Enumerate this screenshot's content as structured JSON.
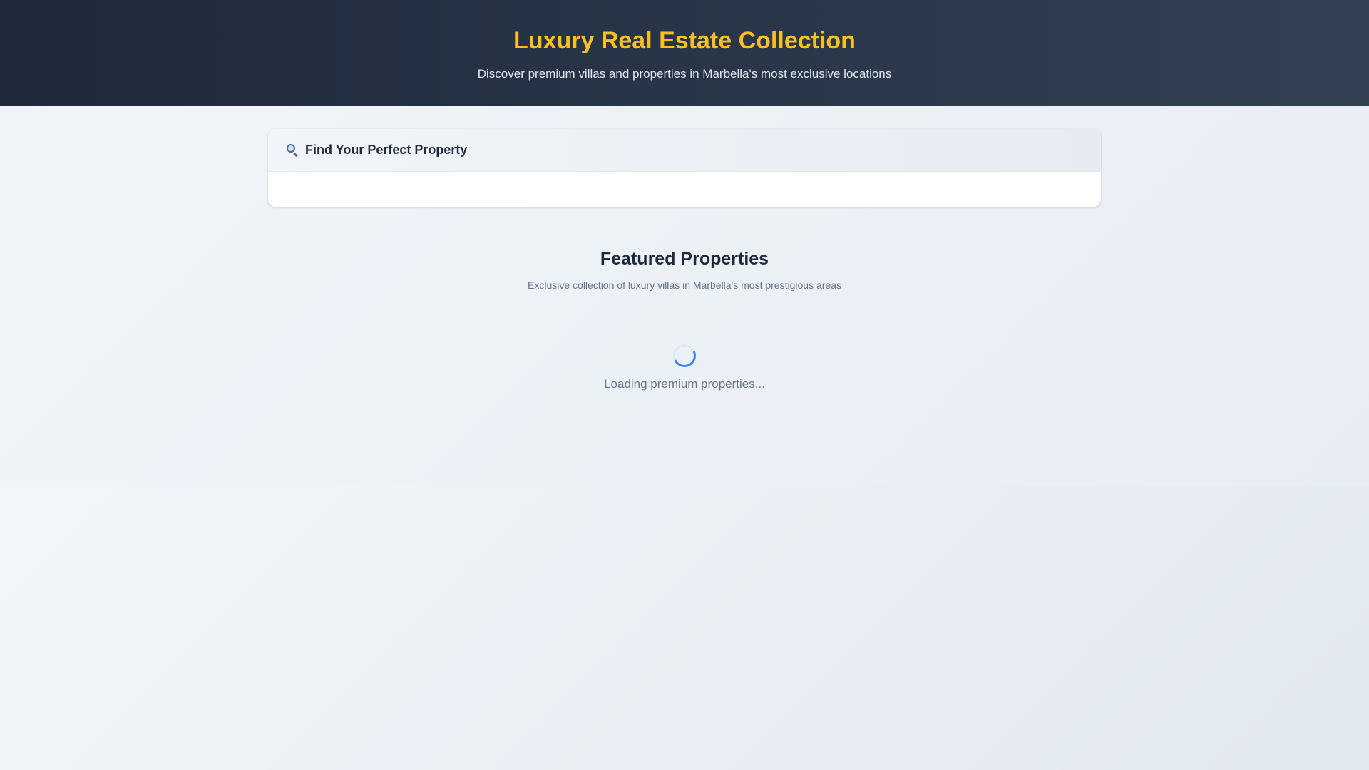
{
  "hero": {
    "title": "Luxury Real Estate Collection",
    "subtitle": "Discover premium villas and properties in Marbella's most exclusive locations"
  },
  "search_card": {
    "icon": "search-icon",
    "title": "Find Your Perfect Property"
  },
  "featured": {
    "title": "Featured Properties",
    "subtitle": "Exclusive collection of luxury villas in Marbella's most prestigious areas"
  },
  "loading": {
    "icon": "spinner-icon",
    "text": "Loading premium properties..."
  },
  "colors": {
    "hero_bg": "#1e293b",
    "accent_gold": "#fbbf24",
    "spinner_blue": "#3b82f6",
    "text_dark": "#1e293b",
    "text_muted": "#64748b"
  }
}
